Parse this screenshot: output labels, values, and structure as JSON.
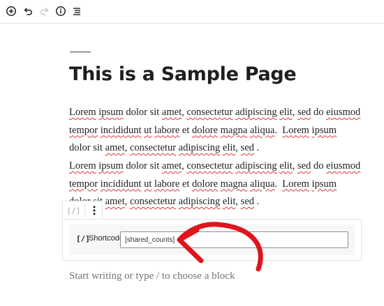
{
  "toolbar": {
    "icons": [
      "add-block-icon",
      "undo-icon",
      "redo-icon",
      "info-icon",
      "list-view-icon"
    ]
  },
  "page": {
    "title": "This is a Sample Page",
    "paragraphs": [
      {
        "lines": [
          [
            {
              "t": "Lorem",
              "sp": true
            },
            {
              "t": " "
            },
            {
              "t": "ipsum",
              "sp": true
            },
            {
              "t": " dolor sit "
            },
            {
              "t": "amet",
              "sp": true
            },
            {
              "t": ", "
            },
            {
              "t": "consectetur",
              "sp": true
            },
            {
              "t": " "
            },
            {
              "t": "adipiscing",
              "sp": true
            },
            {
              "t": " "
            },
            {
              "t": "elit",
              "sp": true
            },
            {
              "t": ", "
            },
            {
              "t": "sed",
              "sp": true
            },
            {
              "t": " do "
            },
            {
              "t": "eiusmod",
              "sp": true
            }
          ],
          [
            {
              "t": "tempor",
              "sp": true
            },
            {
              "t": " "
            },
            {
              "t": "incididunt",
              "sp": true
            },
            {
              "t": " "
            },
            {
              "t": "ut",
              "sp": true
            },
            {
              "t": " "
            },
            {
              "t": "labore",
              "sp": true
            },
            {
              "t": " et "
            },
            {
              "t": "dolore",
              "sp": true
            },
            {
              "t": " "
            },
            {
              "t": "magna",
              "sp": true
            },
            {
              "t": " "
            },
            {
              "t": "aliqua",
              "sp": true
            },
            {
              "t": ".  "
            },
            {
              "t": "Lorem",
              "sp": true
            },
            {
              "t": " "
            },
            {
              "t": "ipsum",
              "sp": true
            }
          ],
          [
            {
              "t": "dolor sit "
            },
            {
              "t": "amet",
              "sp": true
            },
            {
              "t": ", "
            },
            {
              "t": "consectetur",
              "sp": true
            },
            {
              "t": " "
            },
            {
              "t": "adipiscing",
              "sp": true
            },
            {
              "t": " "
            },
            {
              "t": "elit",
              "sp": true
            },
            {
              "t": ", "
            },
            {
              "t": "sed",
              "sp": true
            },
            {
              "t": " ."
            }
          ]
        ]
      },
      {
        "lines": [
          [
            {
              "t": "Lorem",
              "sp": true
            },
            {
              "t": " "
            },
            {
              "t": "ipsum",
              "sp": true
            },
            {
              "t": " dolor sit "
            },
            {
              "t": "amet",
              "sp": true
            },
            {
              "t": ", "
            },
            {
              "t": "consectetur",
              "sp": true
            },
            {
              "t": " "
            },
            {
              "t": "adipiscing",
              "sp": true
            },
            {
              "t": " "
            },
            {
              "t": "elit",
              "sp": true
            },
            {
              "t": ", "
            },
            {
              "t": "sed",
              "sp": true
            },
            {
              "t": " do "
            },
            {
              "t": "eiusmod",
              "sp": true
            }
          ],
          [
            {
              "t": "tempor",
              "sp": true
            },
            {
              "t": " "
            },
            {
              "t": "incididunt",
              "sp": true
            },
            {
              "t": " "
            },
            {
              "t": "ut",
              "sp": true
            },
            {
              "t": " "
            },
            {
              "t": "labore",
              "sp": true
            },
            {
              "t": " et "
            },
            {
              "t": "dolore",
              "sp": true
            },
            {
              "t": " "
            },
            {
              "t": "magna",
              "sp": true
            },
            {
              "t": " "
            },
            {
              "t": "aliqua",
              "sp": true
            },
            {
              "t": ".  "
            },
            {
              "t": "Lorem",
              "sp": true
            },
            {
              "t": " "
            },
            {
              "t": "ipsum",
              "sp": true
            }
          ],
          [
            {
              "t": "dolor sit "
            },
            {
              "t": "amet",
              "sp": true
            },
            {
              "t": ", "
            },
            {
              "t": "consectetur",
              "sp": true
            },
            {
              "t": " "
            },
            {
              "t": "adipiscing",
              "sp": true
            },
            {
              "t": " "
            },
            {
              "t": "elit",
              "sp": true
            },
            {
              "t": ", "
            },
            {
              "t": "sed",
              "sp": true
            },
            {
              "t": " ."
            }
          ]
        ]
      }
    ]
  },
  "block_toolbar": {
    "type_icon": "[/]",
    "more_icon": "more-options-icon"
  },
  "shortcode": {
    "icon": "[/]",
    "label": "Shortcode",
    "value": "[shared_counts]"
  },
  "placeholder": "Start writing or type / to choose a block",
  "colors": {
    "spellcheck_underline": "#d63638",
    "annotation_arrow": "#e0141c",
    "border": "#e2e4e7",
    "text": "#1e1e1e"
  }
}
